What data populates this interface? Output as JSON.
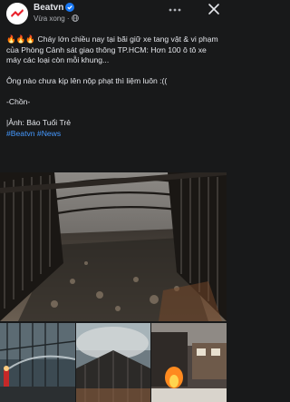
{
  "header": {
    "page_name": "Beatvn",
    "meta": "Vừa xong ·",
    "icons": {
      "verified": "verified-badge-icon",
      "audience": "globe-icon",
      "more": "more-options-icon",
      "close": "close-icon"
    }
  },
  "caption": {
    "emoji": "🔥🔥🔥",
    "line1": " Cháy lớn chiều nay tại bãi giữ xe tang vật & vi phạm của Phòng Cảnh sát giao thông TP.HCM: Hơn 100 ô tô xe máy các loại còn mỗi khung...",
    "line2": "Ông nào chưa kịp lên nộp phạt thì liệm luôn :((",
    "line3": "-Chồn-",
    "line4": "|Ảnh: Báo Tuổi Trẻ",
    "hashtags": "#Beatvn #News"
  },
  "colors": {
    "background": "#18191a",
    "text": "#e4e6eb",
    "secondary": "#b0b3b8",
    "link": "#4599ff",
    "verified": "#1877f2"
  }
}
